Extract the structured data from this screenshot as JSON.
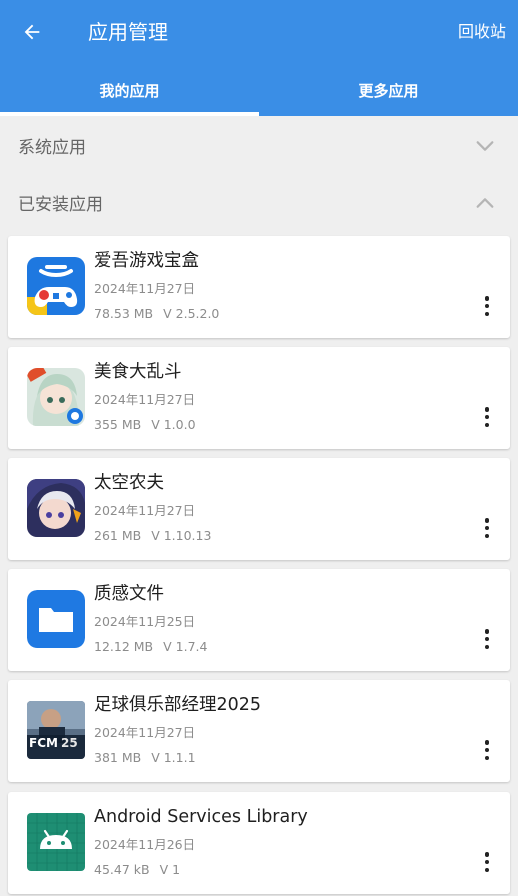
{
  "header": {
    "title": "应用管理",
    "recycle_label": "回收站",
    "back_icon": "arrow-left-icon"
  },
  "tabs": [
    {
      "label": "我的应用",
      "active": true
    },
    {
      "label": "更多应用",
      "active": false
    }
  ],
  "sections": {
    "system": {
      "label": "系统应用",
      "expanded": false
    },
    "installed": {
      "label": "已安装应用",
      "expanded": true
    }
  },
  "apps": [
    {
      "name": "爱吾游戏宝盒",
      "date": "2024年11月27日",
      "size": "78.53 MB",
      "version": "V 2.5.2.0",
      "icon": "game-box-icon"
    },
    {
      "name": "美食大乱斗",
      "date": "2024年11月27日",
      "size": "355 MB",
      "version": "V 1.0.0",
      "icon": "food-battle-icon"
    },
    {
      "name": "太空农夫",
      "date": "2024年11月27日",
      "size": "261 MB",
      "version": "V 1.10.13",
      "icon": "space-farmer-icon"
    },
    {
      "name": "质感文件",
      "date": "2024年11月25日",
      "size": "12.12 MB",
      "version": "V 1.7.4",
      "icon": "folder-icon"
    },
    {
      "name": "足球俱乐部经理2025",
      "date": "2024年11月27日",
      "size": "381 MB",
      "version": "V 1.1.1",
      "icon": "fcm25-icon"
    },
    {
      "name": "Android Services Library",
      "date": "2024年11月26日",
      "size": "45.47 kB",
      "version": "V 1",
      "icon": "android-icon"
    }
  ],
  "colors": {
    "appbar": "#3a8ee6",
    "background": "#efefef"
  }
}
